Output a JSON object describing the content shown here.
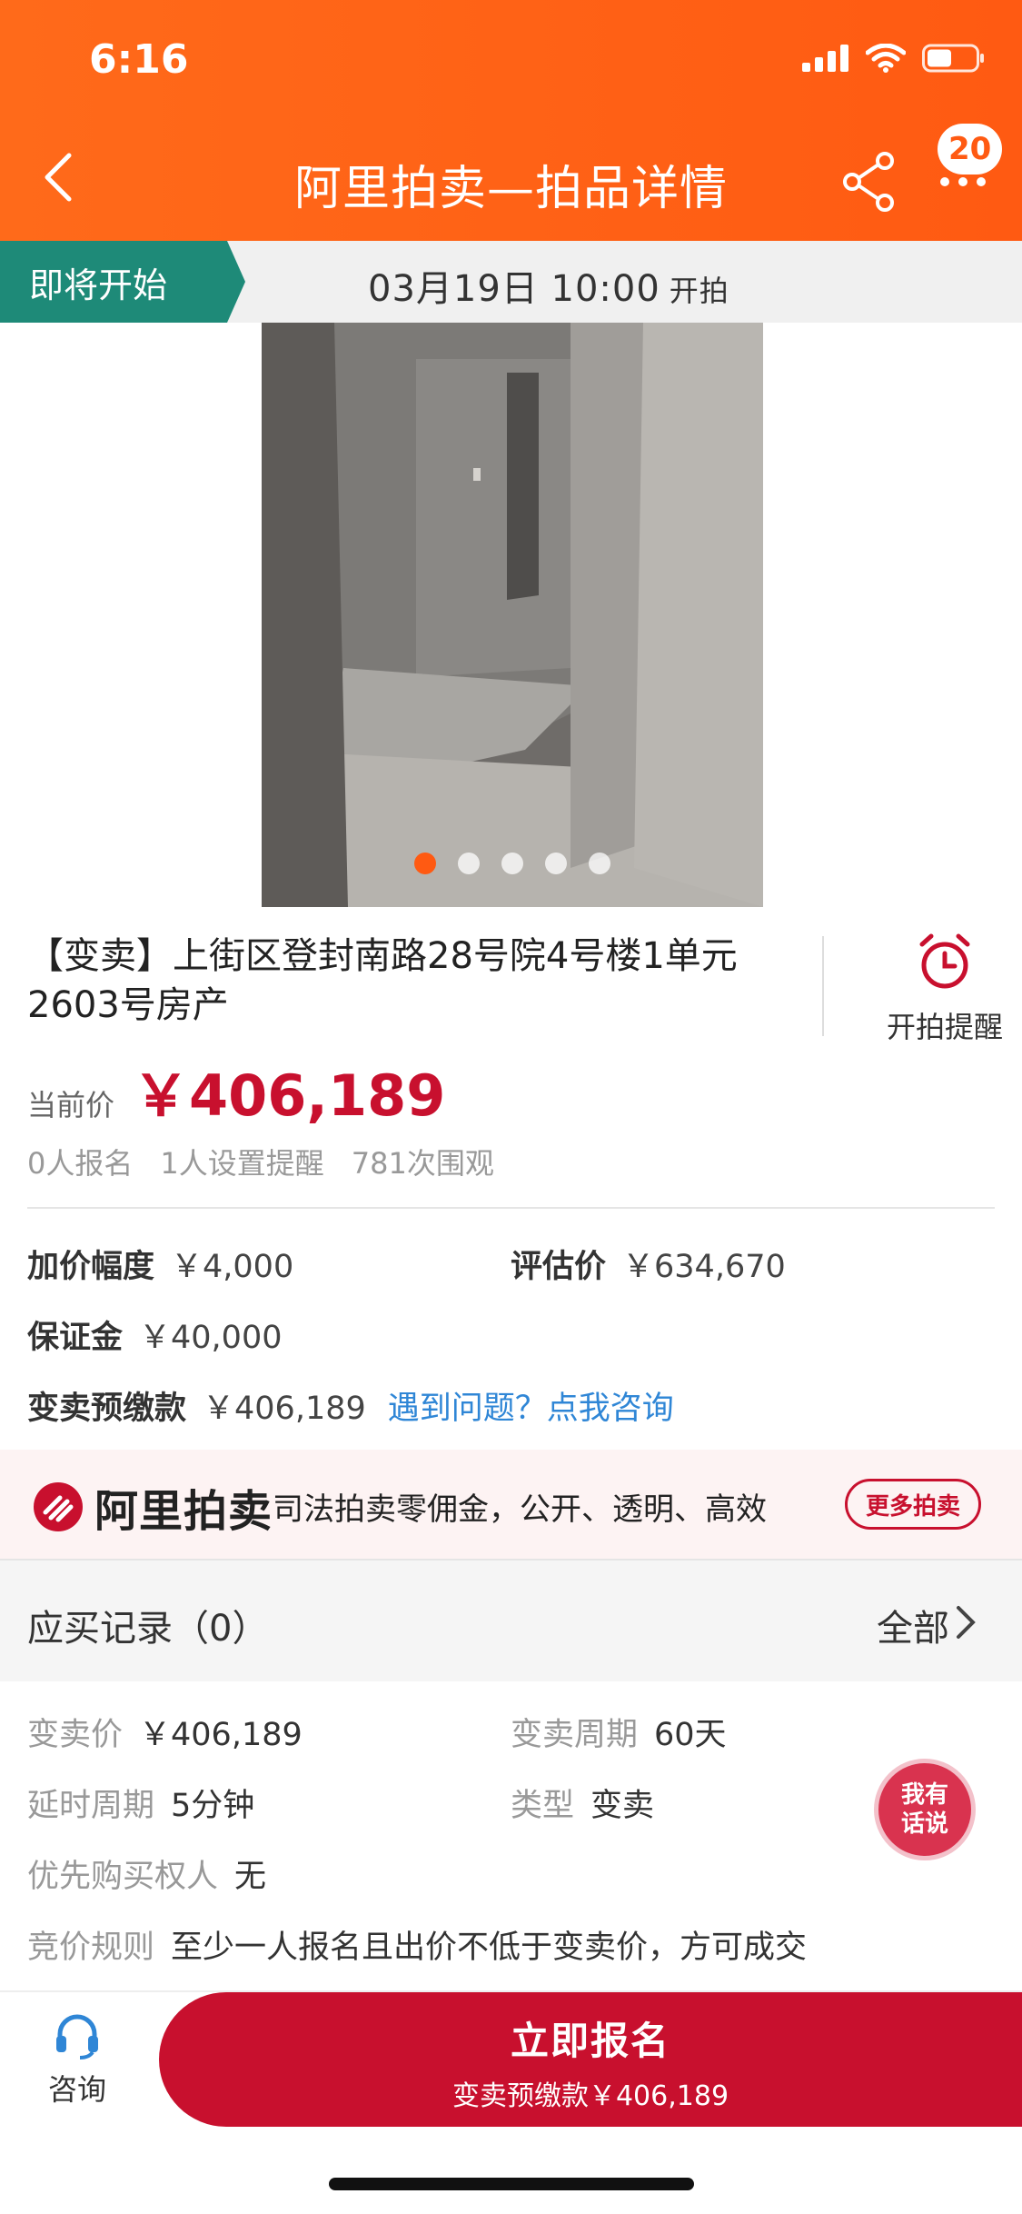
{
  "status": {
    "time": "6:16"
  },
  "nav": {
    "title": "阿里拍卖—拍品详情",
    "badge": "20"
  },
  "banner": {
    "tag": "即将开始",
    "date_time": "03月19日 10:00",
    "start_label": "开拍"
  },
  "gallery": {
    "count": 5,
    "active": 1
  },
  "item": {
    "title": "【变卖】上街区登封南路28号院4号楼1单元2603号房产",
    "remind_label": "开拍提醒",
    "price_label": "当前价",
    "price_value": "￥406,189",
    "stats": [
      "0人报名",
      "1人设置提醒",
      "781次围观"
    ]
  },
  "info": {
    "increment_label": "加价幅度",
    "increment_value": "￥4,000",
    "appraisal_label": "评估价",
    "appraisal_value": "￥634,670",
    "deposit_label": "保证金",
    "deposit_value": "￥40,000",
    "prepay_label": "变卖预缴款",
    "prepay_value": "￥406,189",
    "help_link": "遇到问题？点我咨询"
  },
  "ali": {
    "logo": "阿里拍卖",
    "slogan": "司法拍卖零佣金，公开、透明、高效",
    "more": "更多拍卖"
  },
  "records": {
    "title": "应买记录（0）",
    "all": "全部"
  },
  "details": {
    "sell_price_label": "变卖价",
    "sell_price_value": "￥406,189",
    "period_label": "变卖周期",
    "period_value": "60天",
    "delay_label": "延时周期",
    "delay_value": "5分钟",
    "type_label": "类型",
    "type_value": "变卖",
    "priority_label": "优先购买权人",
    "priority_value": "无",
    "rule_label": "竞价规则",
    "rule_value": "至少一人报名且出价不低于变卖价，方可成交"
  },
  "fab": {
    "line1": "我有",
    "line2": "话说"
  },
  "bottom": {
    "consult": "咨询",
    "cta_main": "立即报名",
    "cta_sub": "变卖预缴款￥406,189"
  }
}
